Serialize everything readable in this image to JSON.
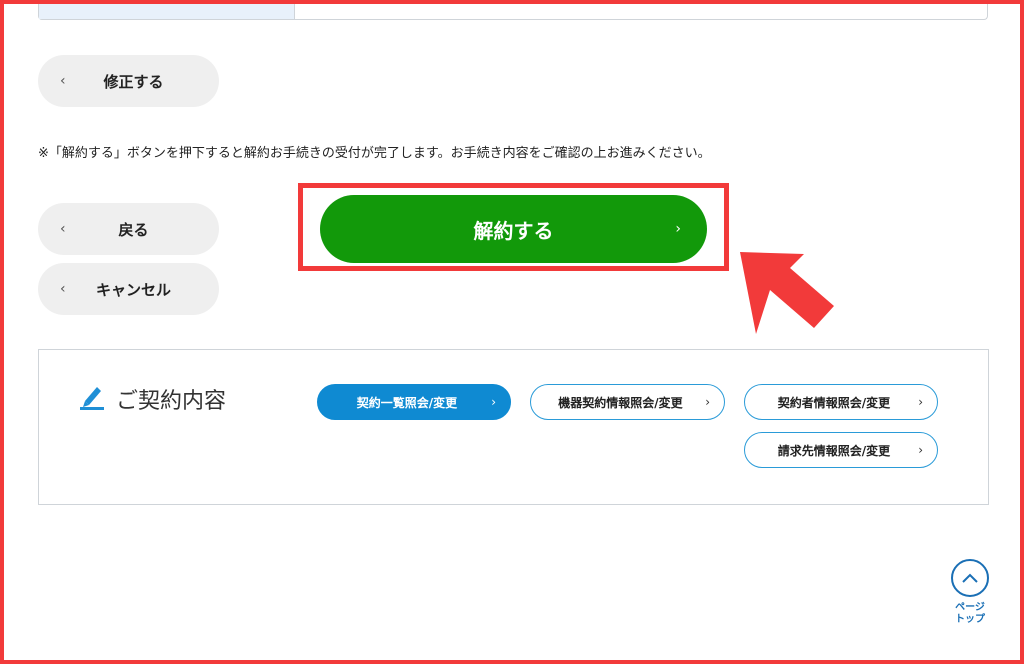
{
  "buttons": {
    "edit_label": "修正する",
    "back_label": "戻る",
    "cancel_label": "キャンセル",
    "primary_label": "解約する"
  },
  "notice_text": "※「解約する」ボタンを押下すると解約お手続きの受付が完了します。お手続き内容をご確認の上お進みください。",
  "contract_panel": {
    "title": "ご契約内容",
    "links": [
      {
        "label": "契約一覧照会/変更",
        "active": true
      },
      {
        "label": "機器契約情報照会/変更",
        "active": false
      },
      {
        "label": "契約者情報照会/変更",
        "active": false
      },
      {
        "label": "請求先情報照会/変更",
        "active": false
      }
    ]
  },
  "page_top": {
    "line1": "ページ",
    "line2": "トップ"
  },
  "icons": {
    "chevron_left": "‹",
    "chevron_right": "›",
    "pencil": "pencil-icon",
    "arrow_up": "chevron-up-icon"
  },
  "colors": {
    "primary_green": "#12990a",
    "highlight_red": "#f23a3a",
    "link_blue": "#0f8ad2"
  }
}
